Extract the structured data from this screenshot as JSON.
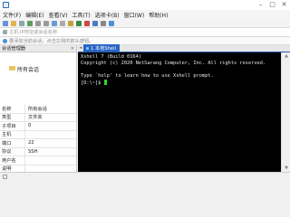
{
  "menu": [
    "文件(F)",
    "编辑(E)",
    "查看(V)",
    "工具(T)",
    "选项卡(B)",
    "窗口(W)",
    "帮助(H)"
  ],
  "address_placeholder": "主机,IP地址或会话名称",
  "info_text": "要添加当前会话，点击左侧的箭头按钮。",
  "panel": {
    "title": "会话管理器",
    "tree_item": "所有会话",
    "properties": [
      {
        "k": "名称",
        "v": "所有会话"
      },
      {
        "k": "类型",
        "v": "文件夹"
      },
      {
        "k": "子项目",
        "v": "0"
      },
      {
        "k": "主机",
        "v": ""
      },
      {
        "k": "端口",
        "v": "22"
      },
      {
        "k": "协议",
        "v": "SSH"
      },
      {
        "k": "用户名",
        "v": ""
      },
      {
        "k": "说明",
        "v": ""
      }
    ]
  },
  "tab": {
    "label": "1 本地Shell"
  },
  "terminal": {
    "lines": [
      "Xshell 7 (Build 0164)",
      "Copyright (c) 2020 NetSarang Computer, Inc. All rights reserved.",
      "",
      "Type `help' to learn how to use Xshell prompt.",
      "[D:\\~]$ "
    ]
  },
  "colors": {
    "tab_active": "#2a64c5",
    "terminal_bg": "#000000",
    "cursor": "#2fd12f"
  }
}
